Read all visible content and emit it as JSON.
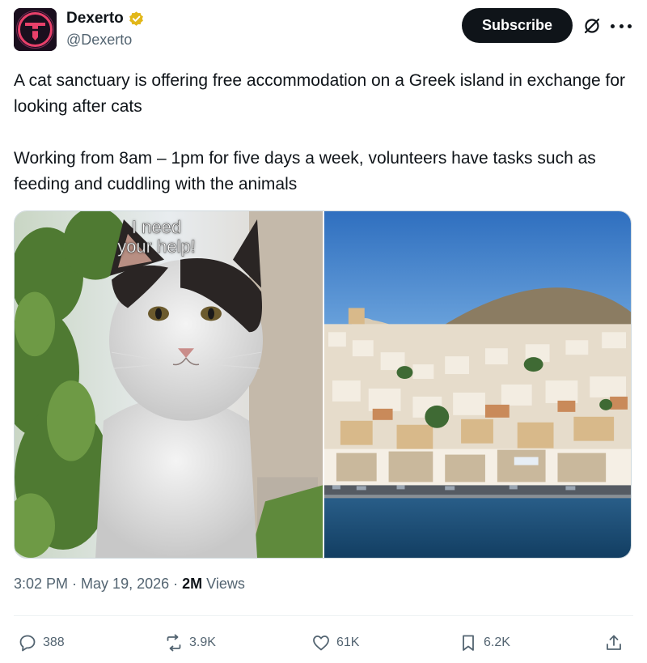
{
  "author": {
    "name": "Dexerto",
    "handle": "@Dexerto",
    "verified_badge_color": "#e2b719"
  },
  "header": {
    "subscribe_label": "Subscribe",
    "icons": [
      "grok-icon",
      "more-icon"
    ]
  },
  "tweet": {
    "paragraph_1": "A cat sanctuary is offering free accommodation on a Greek island in exchange for looking after cats",
    "paragraph_2": "Working from 8am – 1pm for five days a week, volunteers have tasks such as feeding and cuddling with the animals"
  },
  "media": {
    "left_image": {
      "overlay_line_1": "I need",
      "overlay_line_2": "your help!"
    }
  },
  "meta": {
    "time": "3:02 PM",
    "separator": "·",
    "date": "May 19, 2026",
    "views_count": "2M",
    "views_label": "Views"
  },
  "actions": {
    "replies": "388",
    "reposts": "3.9K",
    "likes": "61K",
    "bookmarks": "6.2K"
  },
  "colors": {
    "text_primary": "#0f1419",
    "text_secondary": "#536471",
    "subscribe_bg": "#0f1419",
    "divider": "#eff3f4"
  }
}
